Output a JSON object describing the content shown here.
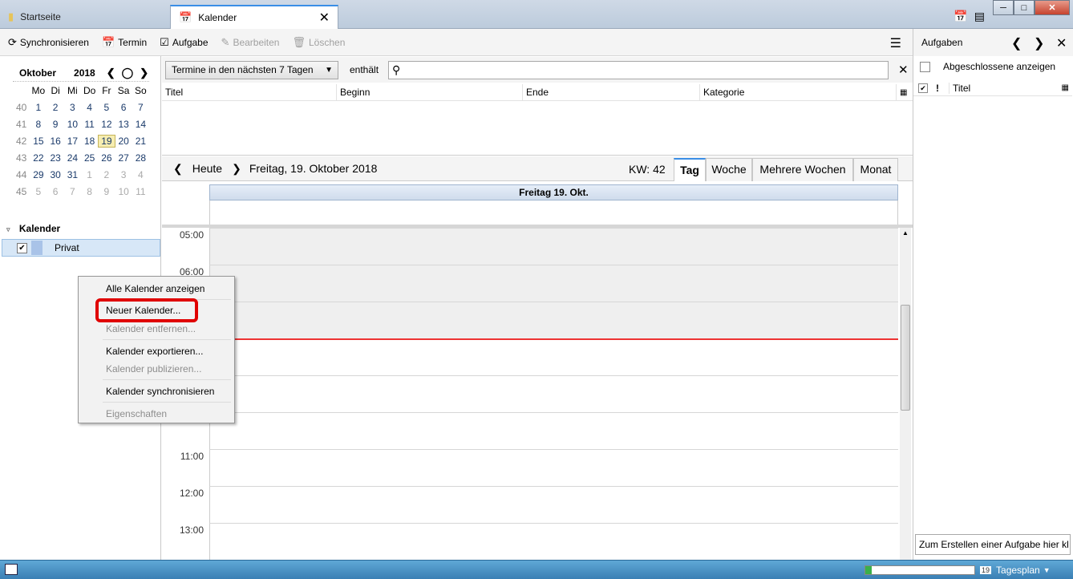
{
  "tabs": [
    {
      "label": "Startseite"
    },
    {
      "label": "Kalender"
    }
  ],
  "toolbar": {
    "sync": "Synchronisieren",
    "event": "Termin",
    "task": "Aufgabe",
    "edit": "Bearbeiten",
    "delete": "Löschen"
  },
  "minimonth": {
    "month": "Oktober",
    "year": "2018",
    "weekdays": [
      "Mo",
      "Di",
      "Mi",
      "Do",
      "Fr",
      "Sa",
      "So"
    ],
    "weeks": [
      {
        "kw": "40",
        "days": [
          "1",
          "2",
          "3",
          "4",
          "5",
          "6",
          "7"
        ]
      },
      {
        "kw": "41",
        "days": [
          "8",
          "9",
          "10",
          "11",
          "12",
          "13",
          "14"
        ]
      },
      {
        "kw": "42",
        "days": [
          "15",
          "16",
          "17",
          "18",
          "19",
          "20",
          "21"
        ]
      },
      {
        "kw": "43",
        "days": [
          "22",
          "23",
          "24",
          "25",
          "26",
          "27",
          "28"
        ]
      },
      {
        "kw": "44",
        "days": [
          "29",
          "30",
          "31",
          "1",
          "2",
          "3",
          "4"
        ]
      },
      {
        "kw": "45",
        "days": [
          "5",
          "6",
          "7",
          "8",
          "9",
          "10",
          "11"
        ]
      }
    ],
    "today": "19"
  },
  "calendar_list": {
    "heading": "Kalender",
    "items": [
      {
        "name": "Privat",
        "color": "#a9c3e8",
        "checked": true
      }
    ]
  },
  "context_menu": {
    "items": [
      {
        "label": "Alle Kalender anzeigen",
        "enabled": true
      },
      {
        "label": "Neuer Kalender...",
        "enabled": true
      },
      {
        "label": "Kalender entfernen...",
        "enabled": false
      },
      {
        "label": "Kalender exportieren...",
        "enabled": true
      },
      {
        "label": "Kalender publizieren...",
        "enabled": false
      },
      {
        "label": "Kalender synchronisieren",
        "enabled": true
      },
      {
        "label": "Eigenschaften",
        "enabled": false
      }
    ]
  },
  "filter": {
    "selected": "Termine in den nächsten 7 Tagen",
    "contains": "enthält",
    "search_value": ""
  },
  "list_columns": [
    "Titel",
    "Beginn",
    "Ende",
    "Kategorie"
  ],
  "navigation": {
    "today": "Heute",
    "date": "Freitag, 19. Oktober 2018",
    "week": "KW: 42",
    "views": [
      "Tag",
      "Woche",
      "Mehrere Wochen",
      "Monat"
    ],
    "selected_view": "Tag"
  },
  "day_view": {
    "header": "Freitag 19. Okt.",
    "hours": [
      "05:00",
      "06:00",
      "",
      "",
      "",
      "",
      "11:00",
      "12:00",
      "13:00"
    ]
  },
  "tasks_pane": {
    "title": "Aufgaben",
    "show_completed": "Abgeschlossene anzeigen",
    "col_priority": "!",
    "col_title": "Titel",
    "new_task": "Zum Erstellen einer Aufgabe hier kl"
  },
  "status": {
    "view_label": "Tagesplan",
    "progress": 0.06
  },
  "colors": {
    "accent": "#3a8ee6",
    "highlight": "#e00000",
    "now_line": "#e33333",
    "today_bg": "#f6edb0"
  }
}
